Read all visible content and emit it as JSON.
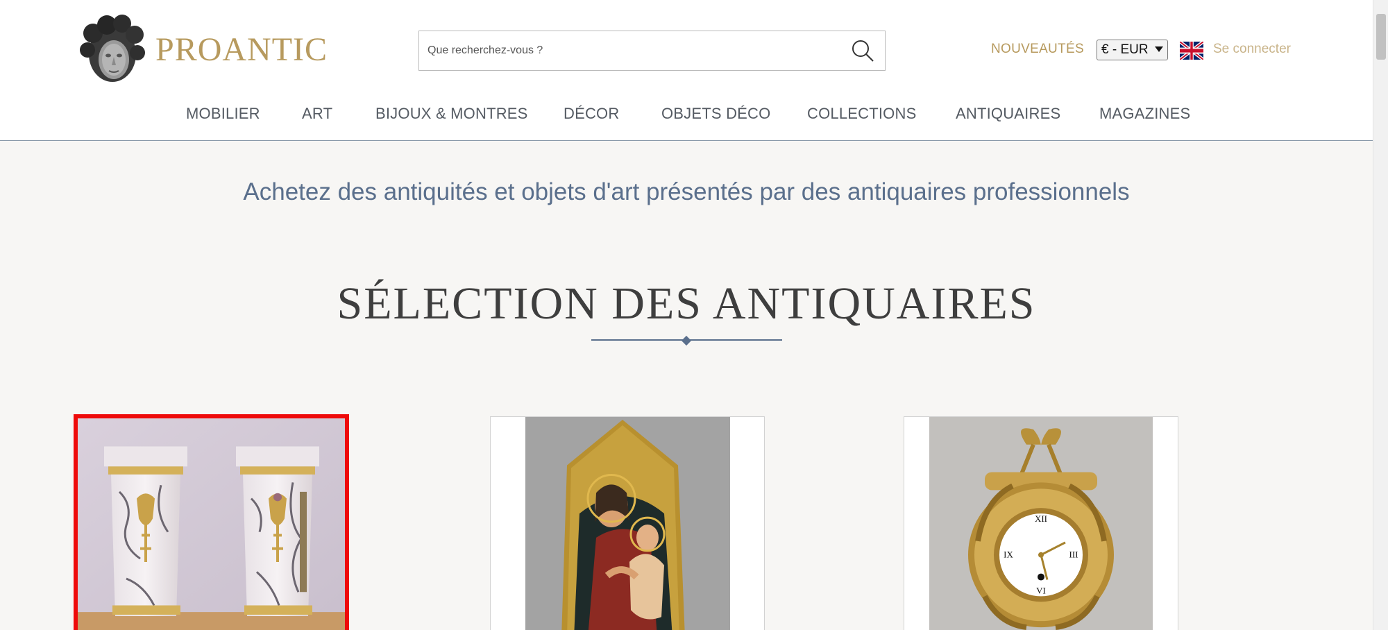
{
  "brand": {
    "name": "PROANTIC"
  },
  "search": {
    "placeholder": "Que recherchez-vous ?"
  },
  "header_links": {
    "new": "NOUVEAUTÉS",
    "currency": "€ - EUR",
    "login": "Se connecter"
  },
  "nav": [
    {
      "label": "MOBILIER"
    },
    {
      "label": "ART"
    },
    {
      "label": "BIJOUX & MONTRES"
    },
    {
      "label": "DÉCOR"
    },
    {
      "label": "OBJETS DÉCO"
    },
    {
      "label": "COLLECTIONS"
    },
    {
      "label": "ANTIQUAIRES"
    },
    {
      "label": "MAGAZINES"
    }
  ],
  "tagline": "Achetez des antiquités et objets d'art présentés par des antiquaires professionnels",
  "section": {
    "title": "SÉLECTION DES ANTIQUAIRES"
  },
  "colors": {
    "gold": "#b79a5e",
    "slate": "#5a6f8c",
    "selected": "#ee0a0a"
  },
  "icons": [
    "logo-head-icon",
    "search-icon",
    "uk-flag-icon"
  ],
  "products": [
    {
      "name": "marble-pedestal-pair-image",
      "selected": true
    },
    {
      "name": "madonna-and-child-painting-image",
      "selected": false
    },
    {
      "name": "gilt-bronze-wall-clock-image",
      "selected": false
    }
  ]
}
